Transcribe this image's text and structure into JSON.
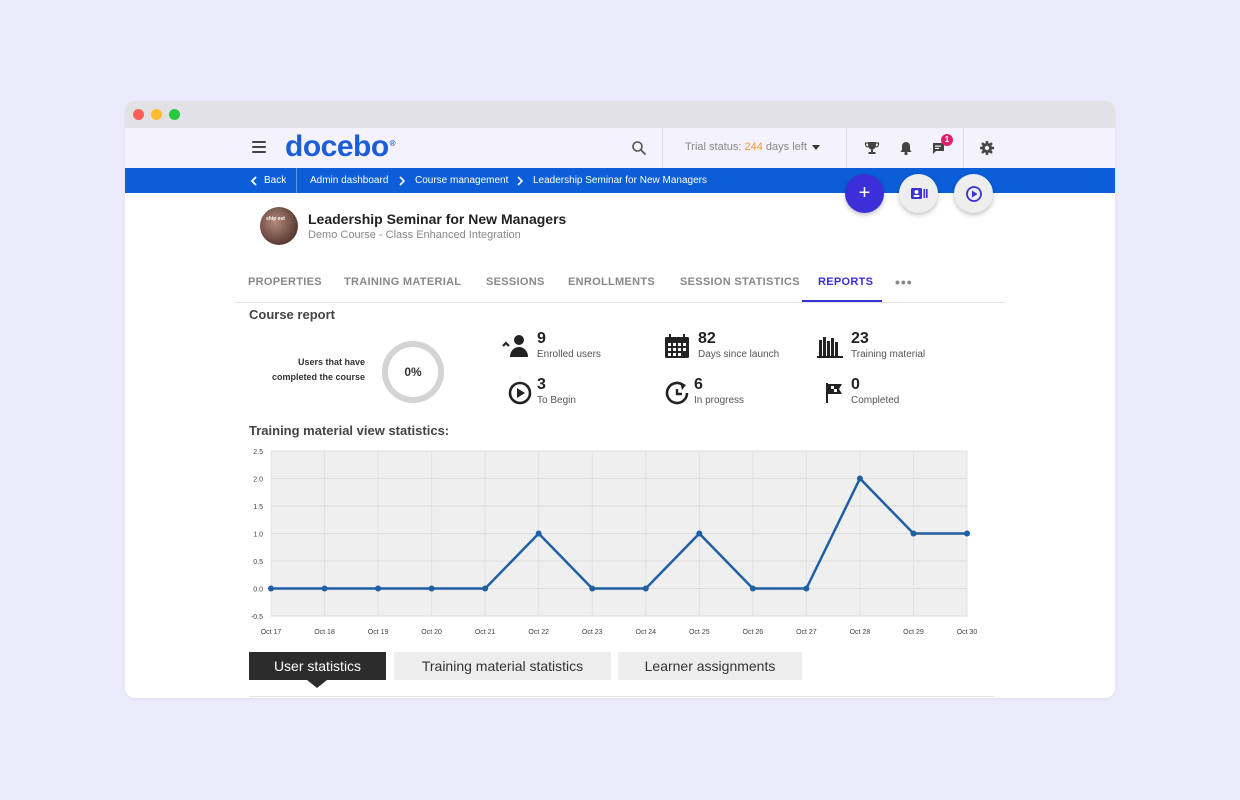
{
  "header": {
    "logo_text": "docebo",
    "logo_mark": "®",
    "trial_prefix": "Trial status: ",
    "trial_days": "244",
    "trial_suffix": " days left",
    "notification_count": "1"
  },
  "breadcrumb": {
    "back": "Back",
    "items": [
      "Admin dashboard",
      "Course management",
      "Leadership Seminar for New Managers"
    ]
  },
  "fab": {
    "add": "+"
  },
  "course": {
    "title": "Leadership Seminar for New Managers",
    "subtitle": "Demo Course - Class Enhanced Integration",
    "avatar_text": "ship eet"
  },
  "tabs": [
    {
      "label": "PROPERTIES",
      "active": false
    },
    {
      "label": "TRAINING MATERIAL",
      "active": false
    },
    {
      "label": "SESSIONS",
      "active": false
    },
    {
      "label": "ENROLLMENTS",
      "active": false
    },
    {
      "label": "SESSION STATISTICS",
      "active": false
    },
    {
      "label": "REPORTS",
      "active": true
    }
  ],
  "tabs_more": "•••",
  "report": {
    "title": "Course report",
    "completion_label_1": "Users that have",
    "completion_label_2": "completed the course",
    "completion_value": "0%",
    "stats": [
      {
        "icon": "user-check-icon",
        "value": "9",
        "label": "Enrolled users"
      },
      {
        "icon": "calendar-icon",
        "value": "82",
        "label": "Days since launch"
      },
      {
        "icon": "books-icon",
        "value": "23",
        "label": "Training material"
      },
      {
        "icon": "play-circle-icon",
        "value": "3",
        "label": "To Begin"
      },
      {
        "icon": "progress-refresh-icon",
        "value": "6",
        "label": "In progress"
      },
      {
        "icon": "flag-icon",
        "value": "0",
        "label": "Completed"
      }
    ]
  },
  "chart_title": "Training material view statistics:",
  "chart_data": {
    "type": "line",
    "categories": [
      "Oct 17",
      "Oct 18",
      "Oct 19",
      "Oct 20",
      "Oct 21",
      "Oct 22",
      "Oct 23",
      "Oct 24",
      "Oct 25",
      "Oct 26",
      "Oct 27",
      "Oct 28",
      "Oct 29",
      "Oct 30"
    ],
    "series": [
      {
        "values": [
          0,
          0,
          0,
          0,
          0,
          1,
          0,
          0,
          1,
          0,
          0,
          2,
          1,
          1
        ]
      }
    ],
    "yticks": [
      "2.5",
      "2.0",
      "1.5",
      "1.0",
      "0.5",
      "0.0",
      "-0.5"
    ],
    "ylim": [
      -0.5,
      2.5
    ],
    "title": "",
    "xlabel": "",
    "ylabel": "",
    "grid": true,
    "line_color": "#1f5fa3"
  },
  "bottom_tabs": [
    {
      "label": "User statistics",
      "active": true
    },
    {
      "label": "Training material statistics",
      "active": false
    },
    {
      "label": "Learner assignments",
      "active": false
    }
  ],
  "colors": {
    "brand_blue": "#1c5ed6",
    "breadcrumb_bar": "#0b5ed7",
    "accent_purple": "#3b2fd8",
    "trial_orange": "#f39a3a",
    "badge_pink": "#e0226e"
  }
}
